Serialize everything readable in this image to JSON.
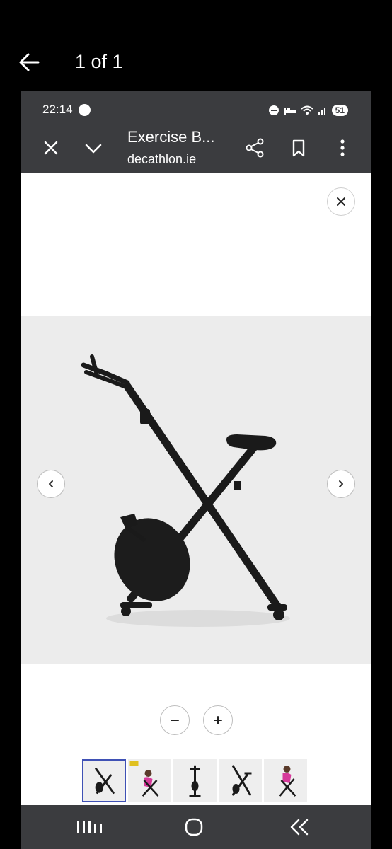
{
  "outer": {
    "counter": "1 of 1"
  },
  "status": {
    "time": "22:14",
    "battery": "51"
  },
  "toolbar": {
    "title": "Exercise B...",
    "domain": "decathlon.ie"
  },
  "product_image": {
    "alt": "Folding exercise bike"
  },
  "thumbnails": [
    {
      "name": "bike-front"
    },
    {
      "name": "bike-with-rider"
    },
    {
      "name": "bike-upright"
    },
    {
      "name": "bike-side"
    },
    {
      "name": "bike-rider-2"
    }
  ]
}
